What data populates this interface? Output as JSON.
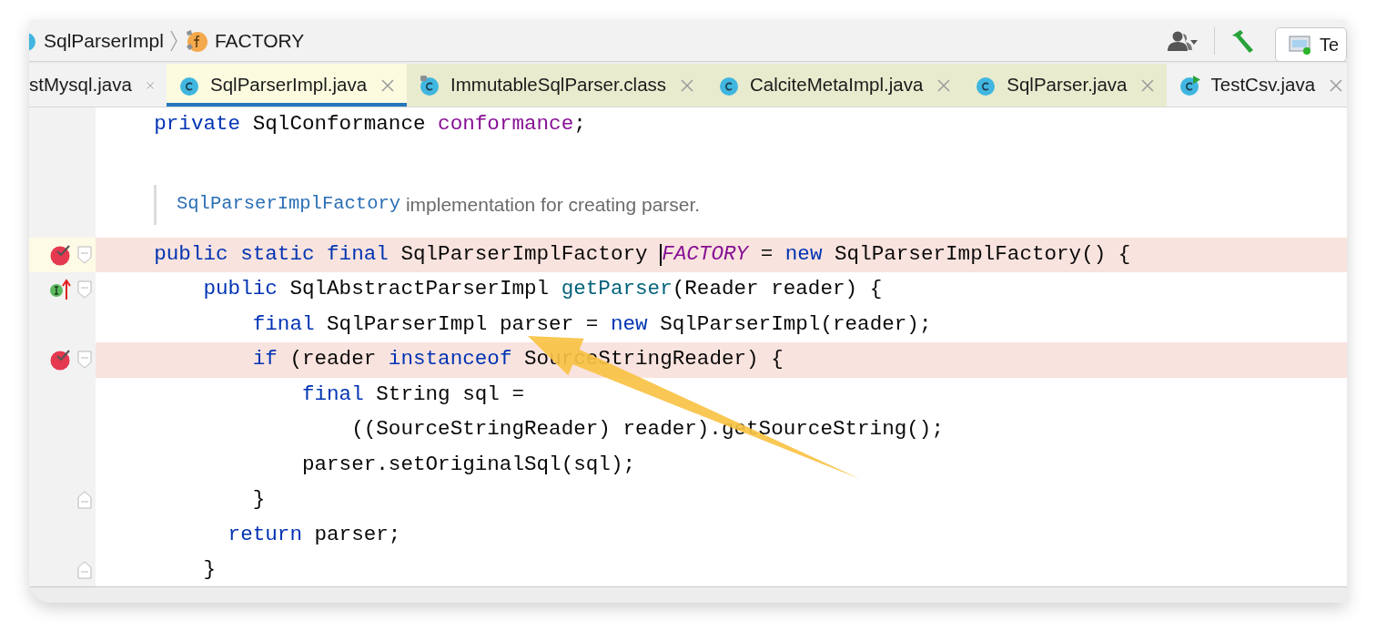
{
  "breadcrumb": [
    {
      "label": "SqlParserImpl",
      "kind": "class"
    },
    {
      "label": "FACTORY",
      "kind": "field"
    }
  ],
  "toolbar": {
    "run_config": "Te"
  },
  "tabs": [
    {
      "label": "stMysql.java",
      "kind": "plain",
      "selected": false,
      "color": "#f2f2f2"
    },
    {
      "label": "SqlParserImpl.java",
      "kind": "class",
      "selected": true,
      "color": "#fcfbe0"
    },
    {
      "label": "ImmutableSqlParser.class",
      "kind": "locked",
      "selected": false,
      "color": "#e9ebce"
    },
    {
      "label": "CalciteMetaImpl.java",
      "kind": "class",
      "selected": false,
      "color": "#e9ebce"
    },
    {
      "label": "SqlParser.java",
      "kind": "class",
      "selected": false,
      "color": "#e9ebce"
    },
    {
      "label": "TestCsv.java",
      "kind": "runnable",
      "selected": false,
      "color": "#f2f2f2"
    }
  ],
  "editor": {
    "lines": [
      {
        "kind": "code",
        "highlighted": false,
        "current": false,
        "breakpoint": false,
        "implements": false,
        "fold_open": false,
        "fold_close": false,
        "tokens": [
          {
            "kind": "keyword",
            "text": "    private"
          },
          {
            "kind": "plain",
            "text": " SqlConformance "
          },
          {
            "kind": "field",
            "text": "conformance"
          },
          {
            "kind": "plain",
            "text": ";"
          }
        ]
      },
      {
        "kind": "doc",
        "link": "SqlParserImplFactory",
        "text": " implementation for creating parser."
      },
      {
        "kind": "code",
        "highlighted": true,
        "current": true,
        "breakpoint": true,
        "implements": false,
        "fold_open": true,
        "fold_close": false,
        "tokens": [
          {
            "kind": "keyword",
            "text": "    public static final"
          },
          {
            "kind": "plain",
            "text": " SqlParserImplFactory "
          },
          {
            "kind": "caret"
          },
          {
            "kind": "static",
            "text": "FACTORY"
          },
          {
            "kind": "plain",
            "text": " = "
          },
          {
            "kind": "keyword",
            "text": "new"
          },
          {
            "kind": "plain",
            "text": " SqlParserImplFactory() {"
          }
        ]
      },
      {
        "kind": "code",
        "highlighted": false,
        "current": false,
        "breakpoint": false,
        "implements": true,
        "fold_open": true,
        "fold_close": false,
        "tokens": [
          {
            "kind": "keyword",
            "text": "        public"
          },
          {
            "kind": "plain",
            "text": " SqlAbstractParserImpl "
          },
          {
            "kind": "method",
            "text": "getParser"
          },
          {
            "kind": "plain",
            "text": "(Reader reader) {"
          }
        ]
      },
      {
        "kind": "code",
        "highlighted": false,
        "current": false,
        "breakpoint": false,
        "implements": false,
        "fold_open": false,
        "fold_close": false,
        "tokens": [
          {
            "kind": "keyword",
            "text": "            final"
          },
          {
            "kind": "plain",
            "text": " SqlParserImpl parser = "
          },
          {
            "kind": "keyword",
            "text": "new"
          },
          {
            "kind": "plain",
            "text": " SqlParserImpl(reader);"
          }
        ]
      },
      {
        "kind": "code",
        "highlighted": true,
        "current": false,
        "breakpoint": true,
        "implements": false,
        "fold_open": true,
        "fold_close": false,
        "tokens": [
          {
            "kind": "keyword",
            "text": "            if"
          },
          {
            "kind": "plain",
            "text": " (reader "
          },
          {
            "kind": "keyword",
            "text": "instanceof"
          },
          {
            "kind": "plain",
            "text": " SourceStringReader) {"
          }
        ]
      },
      {
        "kind": "code",
        "highlighted": false,
        "current": false,
        "breakpoint": false,
        "implements": false,
        "fold_open": false,
        "fold_close": false,
        "tokens": [
          {
            "kind": "keyword",
            "text": "                final"
          },
          {
            "kind": "plain",
            "text": " String sql ="
          }
        ]
      },
      {
        "kind": "code",
        "highlighted": false,
        "current": false,
        "breakpoint": false,
        "implements": false,
        "fold_open": false,
        "fold_close": false,
        "tokens": [
          {
            "kind": "plain",
            "text": "                    ((SourceStringReader) reader).getSourceString();"
          }
        ]
      },
      {
        "kind": "code",
        "highlighted": false,
        "current": false,
        "breakpoint": false,
        "implements": false,
        "fold_open": false,
        "fold_close": false,
        "tokens": [
          {
            "kind": "plain",
            "text": "                parser.setOriginalSql(sql);"
          }
        ]
      },
      {
        "kind": "code",
        "highlighted": false,
        "current": false,
        "breakpoint": false,
        "implements": false,
        "fold_open": false,
        "fold_close": true,
        "tokens": [
          {
            "kind": "plain",
            "text": "            }"
          }
        ]
      },
      {
        "kind": "code",
        "highlighted": false,
        "current": false,
        "breakpoint": false,
        "implements": false,
        "fold_open": false,
        "fold_close": false,
        "tokens": [
          {
            "kind": "keyword",
            "text": "          return"
          },
          {
            "kind": "plain",
            "text": " parser;"
          }
        ]
      },
      {
        "kind": "code",
        "highlighted": false,
        "current": false,
        "breakpoint": false,
        "implements": false,
        "fold_open": false,
        "fold_close": true,
        "tokens": [
          {
            "kind": "plain",
            "text": "        }"
          }
        ]
      }
    ]
  }
}
